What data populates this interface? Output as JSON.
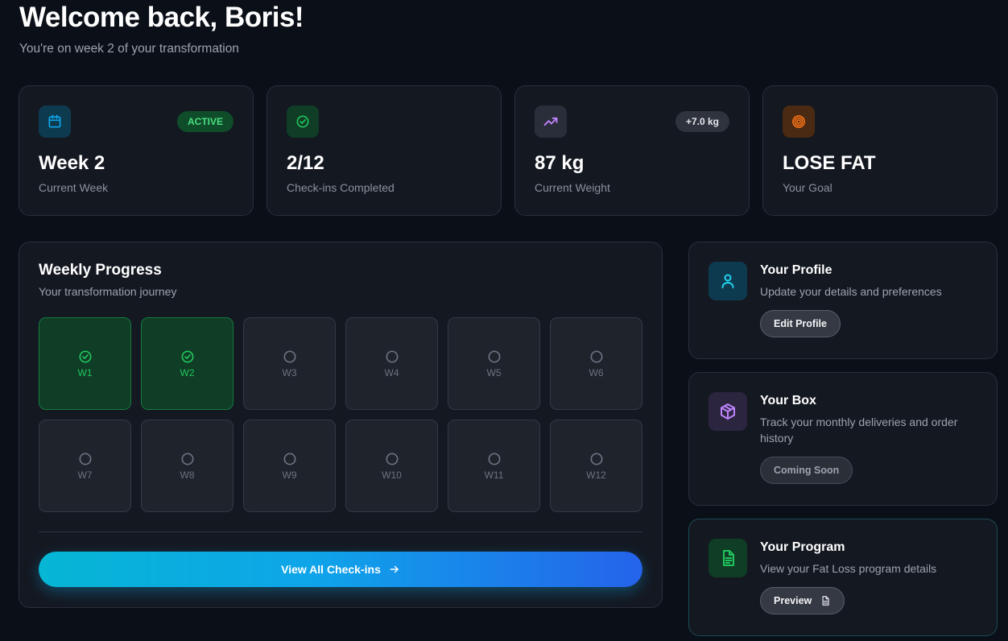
{
  "header": {
    "title": "Welcome back, Boris!",
    "subtitle": "You're on week 2 of your transformation"
  },
  "stats": [
    {
      "icon": "calendar-icon",
      "value": "Week 2",
      "label": "Current Week",
      "badge": "ACTIVE",
      "color": "#0ea5e9"
    },
    {
      "icon": "check-circle-icon",
      "value": "2/12",
      "label": "Check-ins Completed",
      "color": "#22c55e"
    },
    {
      "icon": "trending-up-icon",
      "value": "87 kg",
      "label": "Current Weight",
      "badge": "+7.0 kg",
      "color": "#c084fc"
    },
    {
      "icon": "target-icon",
      "value": "LOSE FAT",
      "label": "Your Goal",
      "color": "#f97316"
    }
  ],
  "progress": {
    "title": "Weekly Progress",
    "subtitle": "Your transformation journey",
    "weeks": [
      {
        "label": "W1",
        "status": "completed"
      },
      {
        "label": "W2",
        "status": "completed"
      },
      {
        "label": "W3",
        "status": "pending"
      },
      {
        "label": "W4",
        "status": "pending"
      },
      {
        "label": "W5",
        "status": "pending"
      },
      {
        "label": "W6",
        "status": "pending"
      },
      {
        "label": "W7",
        "status": "pending"
      },
      {
        "label": "W8",
        "status": "pending"
      },
      {
        "label": "W9",
        "status": "pending"
      },
      {
        "label": "W10",
        "status": "pending"
      },
      {
        "label": "W11",
        "status": "pending"
      },
      {
        "label": "W12",
        "status": "pending"
      }
    ],
    "cta_label": "View All Check-ins"
  },
  "side": {
    "profile": {
      "icon": "user-icon",
      "title": "Your Profile",
      "desc": "Update your details and preferences",
      "button": "Edit Profile"
    },
    "box": {
      "icon": "package-icon",
      "title": "Your Box",
      "desc": "Track your monthly deliveries and order history",
      "button": "Coming Soon"
    },
    "program": {
      "icon": "document-icon",
      "title": "Your Program",
      "desc": "View your Fat Loss program details",
      "button": "Preview"
    }
  },
  "colors": {
    "background": "#0b0f17",
    "card": "#141821",
    "accent_green": "#22c55e",
    "accent_cyan": "#06b6d4",
    "accent_blue": "#2563eb"
  }
}
